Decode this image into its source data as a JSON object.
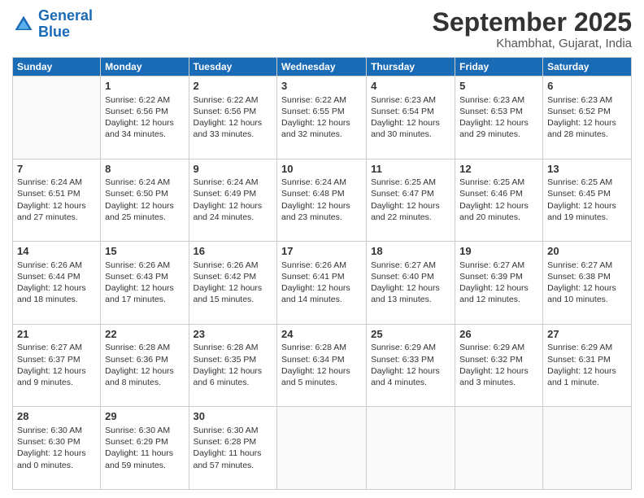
{
  "logo": {
    "line1": "General",
    "line2": "Blue"
  },
  "header": {
    "month": "September 2025",
    "location": "Khambhat, Gujarat, India"
  },
  "days_of_week": [
    "Sunday",
    "Monday",
    "Tuesday",
    "Wednesday",
    "Thursday",
    "Friday",
    "Saturday"
  ],
  "weeks": [
    [
      {
        "day": "",
        "info": ""
      },
      {
        "day": "1",
        "info": "Sunrise: 6:22 AM\nSunset: 6:56 PM\nDaylight: 12 hours\nand 34 minutes."
      },
      {
        "day": "2",
        "info": "Sunrise: 6:22 AM\nSunset: 6:56 PM\nDaylight: 12 hours\nand 33 minutes."
      },
      {
        "day": "3",
        "info": "Sunrise: 6:22 AM\nSunset: 6:55 PM\nDaylight: 12 hours\nand 32 minutes."
      },
      {
        "day": "4",
        "info": "Sunrise: 6:23 AM\nSunset: 6:54 PM\nDaylight: 12 hours\nand 30 minutes."
      },
      {
        "day": "5",
        "info": "Sunrise: 6:23 AM\nSunset: 6:53 PM\nDaylight: 12 hours\nand 29 minutes."
      },
      {
        "day": "6",
        "info": "Sunrise: 6:23 AM\nSunset: 6:52 PM\nDaylight: 12 hours\nand 28 minutes."
      }
    ],
    [
      {
        "day": "7",
        "info": "Sunrise: 6:24 AM\nSunset: 6:51 PM\nDaylight: 12 hours\nand 27 minutes."
      },
      {
        "day": "8",
        "info": "Sunrise: 6:24 AM\nSunset: 6:50 PM\nDaylight: 12 hours\nand 25 minutes."
      },
      {
        "day": "9",
        "info": "Sunrise: 6:24 AM\nSunset: 6:49 PM\nDaylight: 12 hours\nand 24 minutes."
      },
      {
        "day": "10",
        "info": "Sunrise: 6:24 AM\nSunset: 6:48 PM\nDaylight: 12 hours\nand 23 minutes."
      },
      {
        "day": "11",
        "info": "Sunrise: 6:25 AM\nSunset: 6:47 PM\nDaylight: 12 hours\nand 22 minutes."
      },
      {
        "day": "12",
        "info": "Sunrise: 6:25 AM\nSunset: 6:46 PM\nDaylight: 12 hours\nand 20 minutes."
      },
      {
        "day": "13",
        "info": "Sunrise: 6:25 AM\nSunset: 6:45 PM\nDaylight: 12 hours\nand 19 minutes."
      }
    ],
    [
      {
        "day": "14",
        "info": "Sunrise: 6:26 AM\nSunset: 6:44 PM\nDaylight: 12 hours\nand 18 minutes."
      },
      {
        "day": "15",
        "info": "Sunrise: 6:26 AM\nSunset: 6:43 PM\nDaylight: 12 hours\nand 17 minutes."
      },
      {
        "day": "16",
        "info": "Sunrise: 6:26 AM\nSunset: 6:42 PM\nDaylight: 12 hours\nand 15 minutes."
      },
      {
        "day": "17",
        "info": "Sunrise: 6:26 AM\nSunset: 6:41 PM\nDaylight: 12 hours\nand 14 minutes."
      },
      {
        "day": "18",
        "info": "Sunrise: 6:27 AM\nSunset: 6:40 PM\nDaylight: 12 hours\nand 13 minutes."
      },
      {
        "day": "19",
        "info": "Sunrise: 6:27 AM\nSunset: 6:39 PM\nDaylight: 12 hours\nand 12 minutes."
      },
      {
        "day": "20",
        "info": "Sunrise: 6:27 AM\nSunset: 6:38 PM\nDaylight: 12 hours\nand 10 minutes."
      }
    ],
    [
      {
        "day": "21",
        "info": "Sunrise: 6:27 AM\nSunset: 6:37 PM\nDaylight: 12 hours\nand 9 minutes."
      },
      {
        "day": "22",
        "info": "Sunrise: 6:28 AM\nSunset: 6:36 PM\nDaylight: 12 hours\nand 8 minutes."
      },
      {
        "day": "23",
        "info": "Sunrise: 6:28 AM\nSunset: 6:35 PM\nDaylight: 12 hours\nand 6 minutes."
      },
      {
        "day": "24",
        "info": "Sunrise: 6:28 AM\nSunset: 6:34 PM\nDaylight: 12 hours\nand 5 minutes."
      },
      {
        "day": "25",
        "info": "Sunrise: 6:29 AM\nSunset: 6:33 PM\nDaylight: 12 hours\nand 4 minutes."
      },
      {
        "day": "26",
        "info": "Sunrise: 6:29 AM\nSunset: 6:32 PM\nDaylight: 12 hours\nand 3 minutes."
      },
      {
        "day": "27",
        "info": "Sunrise: 6:29 AM\nSunset: 6:31 PM\nDaylight: 12 hours\nand 1 minute."
      }
    ],
    [
      {
        "day": "28",
        "info": "Sunrise: 6:30 AM\nSunset: 6:30 PM\nDaylight: 12 hours\nand 0 minutes."
      },
      {
        "day": "29",
        "info": "Sunrise: 6:30 AM\nSunset: 6:29 PM\nDaylight: 11 hours\nand 59 minutes."
      },
      {
        "day": "30",
        "info": "Sunrise: 6:30 AM\nSunset: 6:28 PM\nDaylight: 11 hours\nand 57 minutes."
      },
      {
        "day": "",
        "info": ""
      },
      {
        "day": "",
        "info": ""
      },
      {
        "day": "",
        "info": ""
      },
      {
        "day": "",
        "info": ""
      }
    ]
  ]
}
